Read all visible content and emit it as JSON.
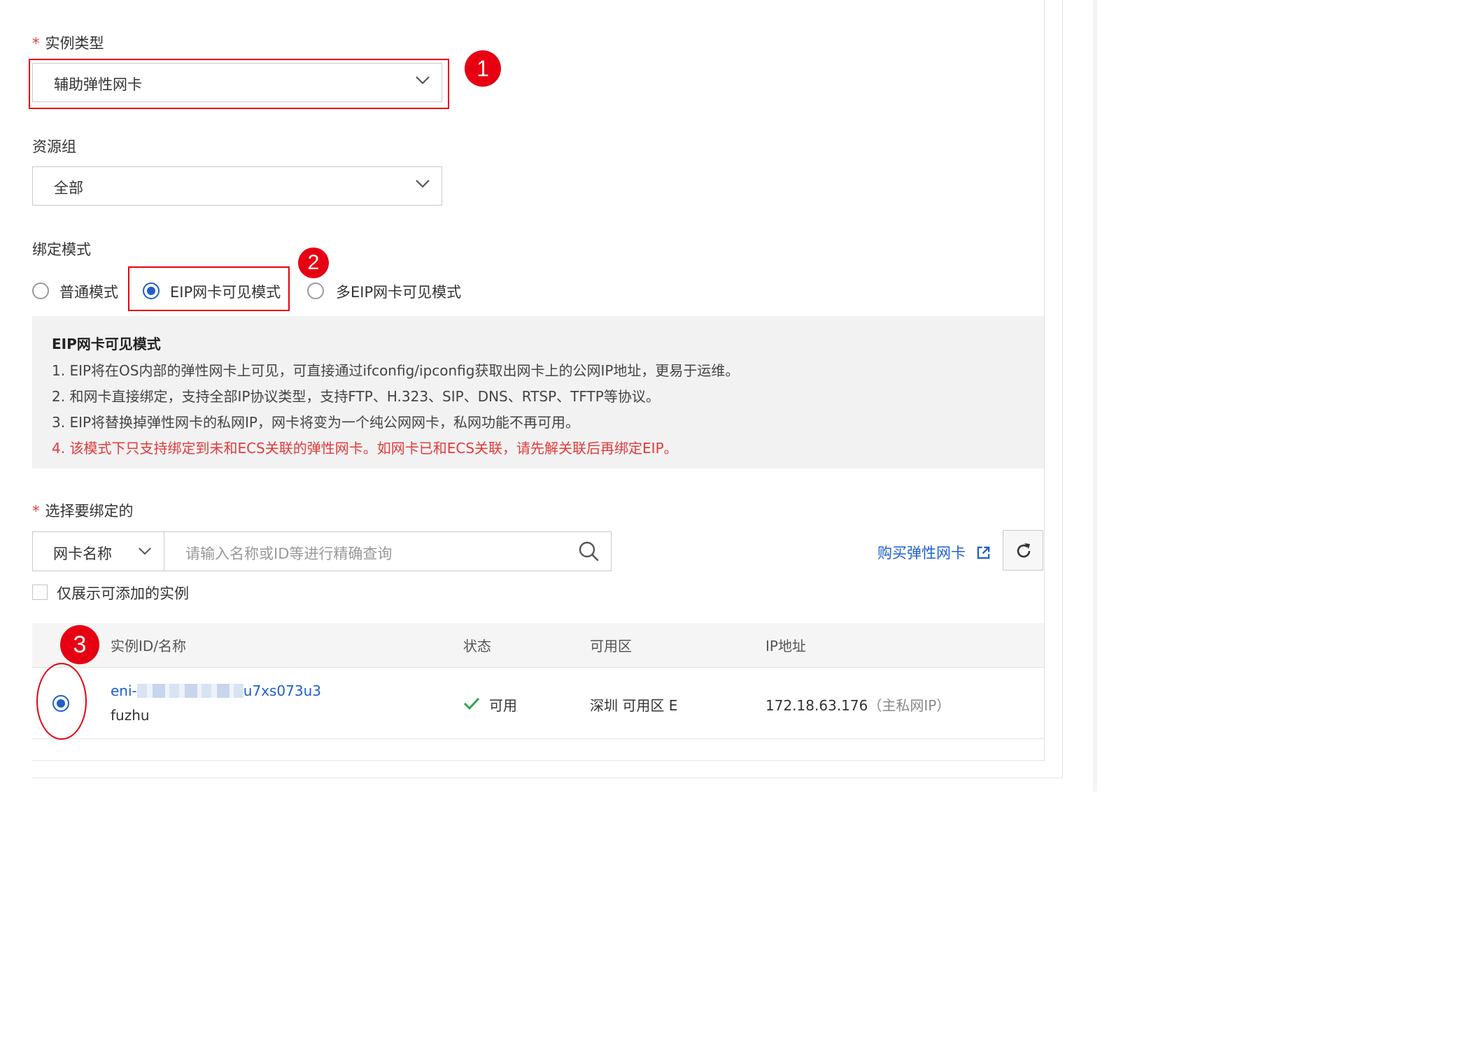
{
  "instance_type": {
    "label": "实例类型",
    "value": "辅助弹性网卡",
    "badge": "1"
  },
  "resource_group": {
    "label": "资源组",
    "value": "全部"
  },
  "bind_mode": {
    "label": "绑定模式",
    "badge": "2",
    "options": [
      {
        "label": "普通模式",
        "selected": false
      },
      {
        "label": "EIP网卡可见模式",
        "selected": true
      },
      {
        "label": "多EIP网卡可见模式",
        "selected": false
      }
    ]
  },
  "info": {
    "title": "EIP网卡可见模式",
    "lines": [
      "1. EIP将在OS内部的弹性网卡上可见，可直接通过ifconfig/ipconfig获取出网卡上的公网IP地址，更易于运维。",
      "2. 和网卡直接绑定，支持全部IP协议类型，支持FTP、H.323、SIP、DNS、RTSP、TFTP等协议。",
      "3. EIP将替换掉弹性网卡的私网IP，网卡将变为一个纯公网网卡，私网功能不再可用。"
    ],
    "warning": "4. 该模式下只支持绑定到未和ECS关联的弹性网卡。如网卡已和ECS关联，请先解关联后再绑定EIP。"
  },
  "select_bind": {
    "label": "选择要绑定的",
    "filter_label": "网卡名称",
    "search_placeholder": "请输入名称或ID等进行精确查询",
    "buy_link": "购买弹性网卡",
    "only_addable_label": "仅展示可添加的实例",
    "only_addable_checked": false
  },
  "table": {
    "badge": "3",
    "headers": [
      "实例ID/名称",
      "状态",
      "可用区",
      "IP地址"
    ],
    "rows": [
      {
        "id_prefix": "eni-",
        "id_suffix": "u7xs073u3",
        "name": "fuzhu",
        "status": "可用",
        "zone": "深圳 可用区 E",
        "ip": "172.18.63.176",
        "ip_note": "（主私网IP）",
        "selected": true
      }
    ]
  },
  "colors": {
    "accent": "#1f5fce",
    "annotation_red": "#e60012",
    "warning_red": "#e23b3b",
    "success_green": "#2ea44f"
  }
}
